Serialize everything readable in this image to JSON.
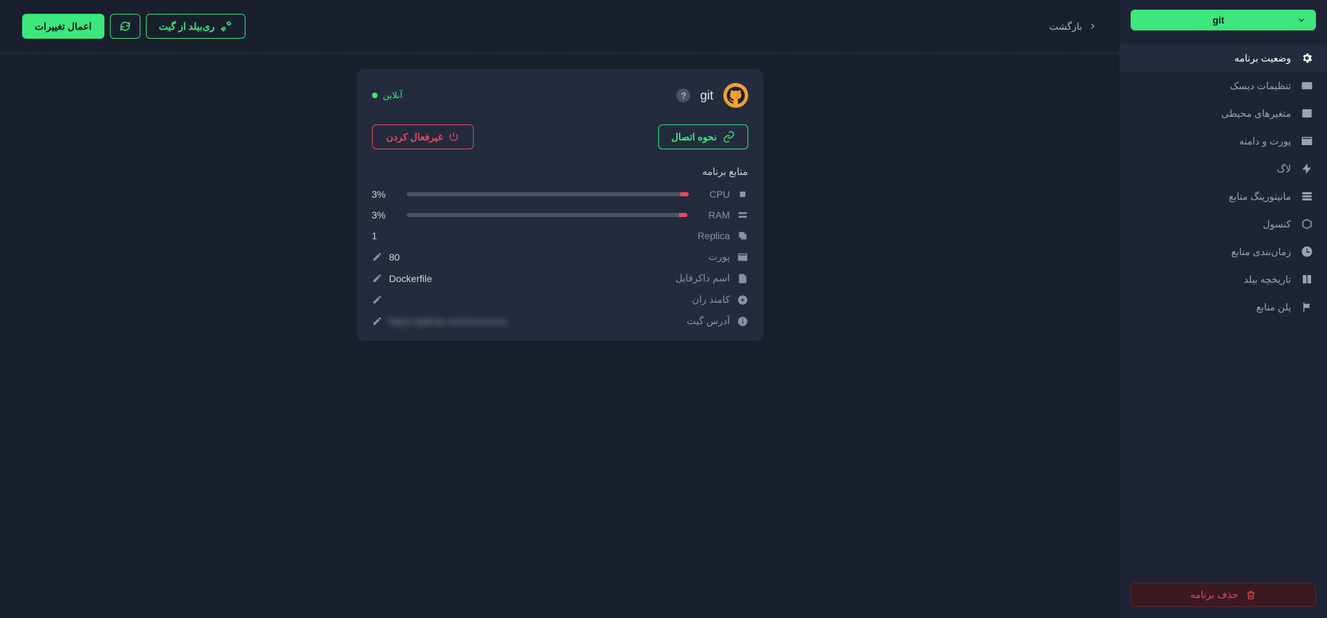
{
  "app": {
    "name": "git"
  },
  "sidebar": {
    "items": [
      {
        "label": "وضعیت برنامه",
        "active": true,
        "icon": "settings"
      },
      {
        "label": "تنظیمات دیسک",
        "active": false,
        "icon": "disk"
      },
      {
        "label": "متغیرهای محیطی",
        "active": false,
        "icon": "env"
      },
      {
        "label": "پورت و دامنه",
        "active": false,
        "icon": "window"
      },
      {
        "label": "لاگ",
        "active": false,
        "icon": "bolt"
      },
      {
        "label": "مانیتورینگ منابع",
        "active": false,
        "icon": "stack"
      },
      {
        "label": "کنسول",
        "active": false,
        "icon": "cube"
      },
      {
        "label": "زمان‌بندی منابع",
        "active": false,
        "icon": "clock"
      },
      {
        "label": "تاریخچه بیلد",
        "active": false,
        "icon": "book"
      },
      {
        "label": "پلن منابع",
        "active": false,
        "icon": "flag"
      }
    ],
    "delete_label": "حذف برنامه"
  },
  "topbar": {
    "back_label": "بازگشت",
    "rebuild_label": "ری‌بیلد از گیت",
    "apply_label": "اعمال تغییرات"
  },
  "card": {
    "app_name": "git",
    "status_label": "آنلاین",
    "connect_label": "نحوه اتصال",
    "deactivate_label": "غیرفعال کردن",
    "resources_title": "منابع برنامه",
    "cpu": {
      "label": "CPU",
      "value": "3%",
      "percent": 3
    },
    "ram": {
      "label": "RAM",
      "value": "3%",
      "percent": 3
    },
    "replica": {
      "label": "Replica",
      "value": "1"
    },
    "port": {
      "label": "پورت",
      "value": "80"
    },
    "dockerfile": {
      "label": "اسم داکرفایل",
      "value": "Dockerfile"
    },
    "command": {
      "label": "کامند ران",
      "value": ""
    },
    "git": {
      "label": "آدرس گیت",
      "value": "https://github.com/xxxxxxxx"
    }
  }
}
